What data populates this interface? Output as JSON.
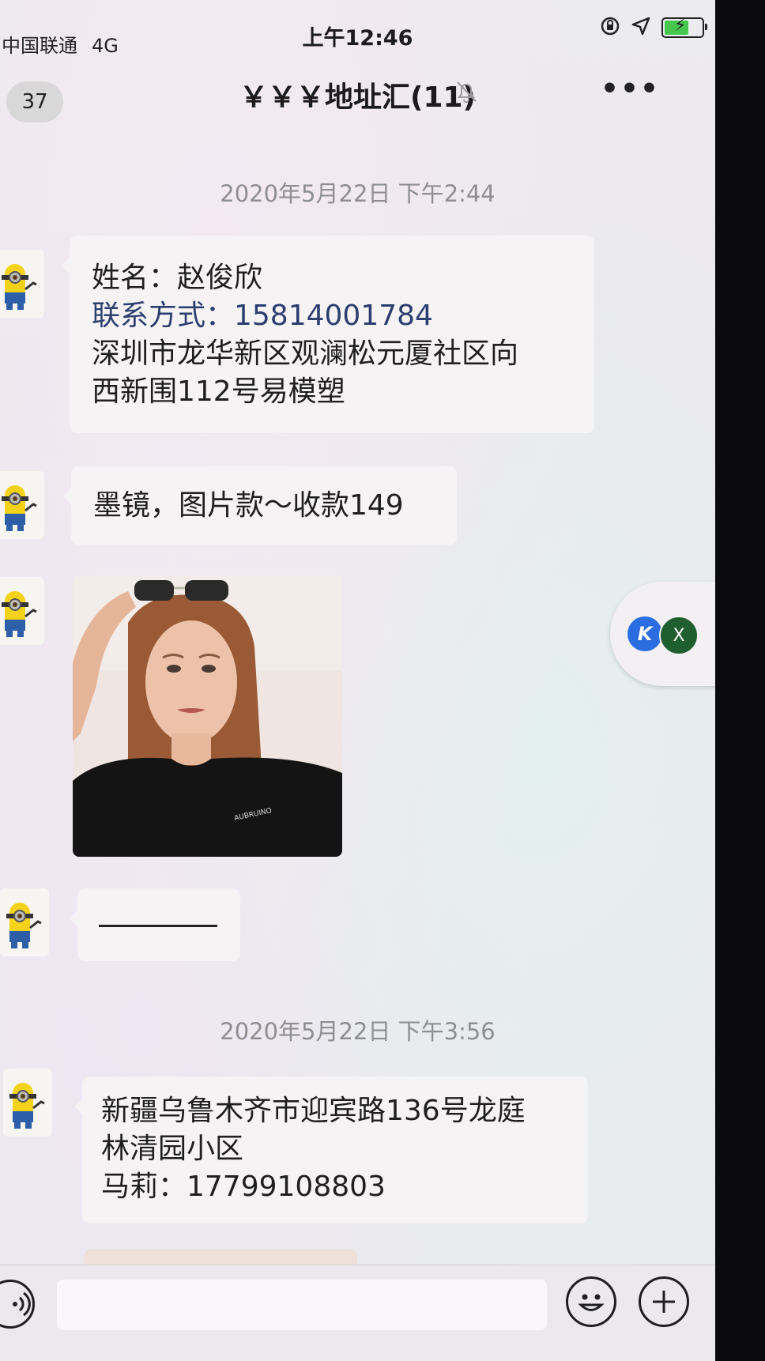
{
  "status_bar": {
    "carrier": "中国联通",
    "network": "4G",
    "time": "上午12:46",
    "icons": [
      "orientation-lock-icon",
      "location-arrow-icon",
      "battery-charging-icon"
    ]
  },
  "nav": {
    "unread_count": "37",
    "title": "￥￥￥地址汇(11)",
    "mute_icon": "bell-slash-icon",
    "more_label": "•••"
  },
  "messages": [
    {
      "type": "timestamp",
      "text": "2020年5月22日 下午2:44"
    },
    {
      "type": "text",
      "sender_avatar": "minion-avatar",
      "lines": [
        "姓名：赵俊欣",
        "联系方式：15814001784",
        "深圳市龙华新区观澜松元厦社区向",
        "西新围112号易模塑"
      ]
    },
    {
      "type": "text",
      "sender_avatar": "minion-avatar",
      "lines": [
        "墨镜，图片款～收款149"
      ]
    },
    {
      "type": "image",
      "sender_avatar": "minion-avatar",
      "shirt_logo": "AUBRUINO"
    },
    {
      "type": "text",
      "sender_avatar": "minion-avatar",
      "lines": []
    },
    {
      "type": "timestamp",
      "text": "2020年5月22日 下午3:56"
    },
    {
      "type": "text",
      "sender_avatar": "minion-avatar",
      "lines": [
        "新疆乌鲁木齐市迎宾路136号龙庭",
        "林清园小区",
        "马莉：17799108803"
      ]
    }
  ],
  "floating_widget": {
    "left_icon": "K",
    "right_icon": "X"
  },
  "input_bar": {
    "voice_icon": "voice-icon",
    "emoji_icon": "emoji-icon",
    "plus_icon": "plus-icon"
  },
  "colors": {
    "link_phone": "#2c3e6f",
    "bubble": "#f6f3f5",
    "timestamp": "#8e8e90"
  }
}
